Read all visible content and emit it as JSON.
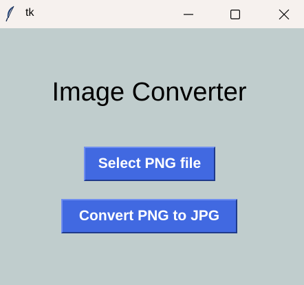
{
  "window": {
    "title": "tk",
    "background_color": "#c0cdcd",
    "titlebar_color": "#f6f1ee",
    "icons": {
      "app": "feather-icon",
      "minimize": "minimize-icon",
      "maximize": "maximize-icon",
      "close": "close-icon"
    }
  },
  "main": {
    "heading": "Image Converter",
    "select_button_label": "Select PNG file",
    "convert_button_label": "Convert PNG to JPG",
    "button_color": "#4169e1"
  }
}
